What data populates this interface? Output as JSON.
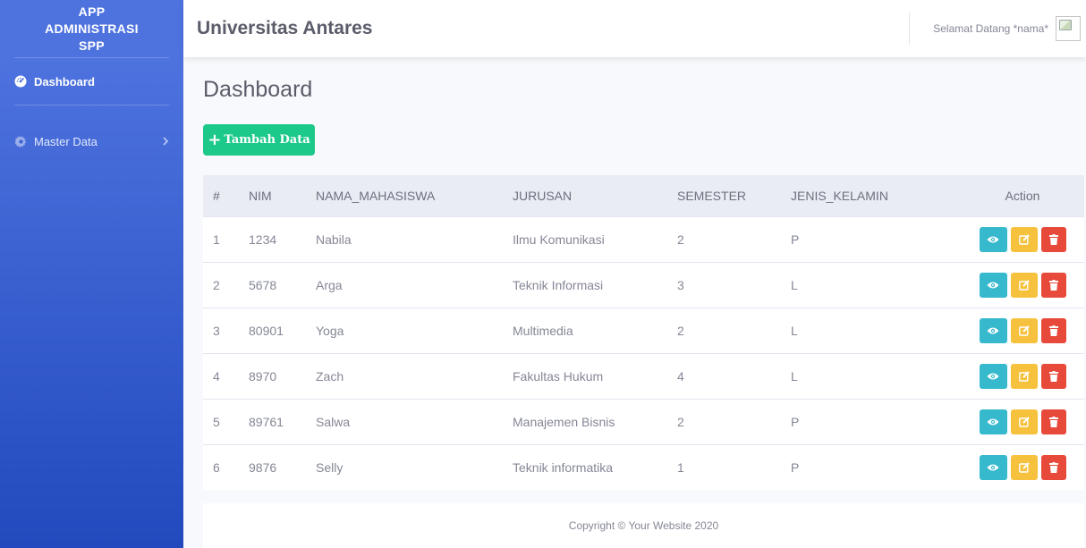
{
  "sidebar": {
    "brand_lines": [
      "APP",
      "ADMINISTRASI",
      "SPP"
    ],
    "items": [
      {
        "label": "Dashboard",
        "icon": "tachometer-icon",
        "active": true
      },
      {
        "label": "Master Data",
        "icon": "gear-icon",
        "active": false,
        "chevron": "chevron-right-icon"
      }
    ]
  },
  "topbar": {
    "title": "Universitas Antares",
    "greeting": "Selamat Datang *nama*"
  },
  "page": {
    "title": "Dashboard",
    "add_button": "Tambah Data"
  },
  "table": {
    "headers": [
      "#",
      "NIM",
      "NAMA_MAHASISWA",
      "JURUSAN",
      "SEMESTER",
      "JENIS_KELAMIN",
      "Action"
    ],
    "rows": [
      {
        "no": "1",
        "nim": "1234",
        "nama": "Nabila",
        "jurusan": "Ilmu Komunikasi",
        "semester": "2",
        "jk": "P"
      },
      {
        "no": "2",
        "nim": "5678",
        "nama": "Arga",
        "jurusan": "Teknik Informasi",
        "semester": "3",
        "jk": "L"
      },
      {
        "no": "3",
        "nim": "80901",
        "nama": "Yoga",
        "jurusan": "Multimedia",
        "semester": "2",
        "jk": "L"
      },
      {
        "no": "4",
        "nim": "8970",
        "nama": "Zach",
        "jurusan": "Fakultas Hukum",
        "semester": "4",
        "jk": "L"
      },
      {
        "no": "5",
        "nim": "89761",
        "nama": "Salwa",
        "jurusan": "Manajemen Bisnis",
        "semester": "2",
        "jk": "P"
      },
      {
        "no": "6",
        "nim": "9876",
        "nama": "Selly",
        "jurusan": "Teknik informatika",
        "semester": "1",
        "jk": "P"
      }
    ]
  },
  "footer": {
    "text": "Copyright © Your Website 2020"
  },
  "colors": {
    "sidebar_top": "#4e73df",
    "sidebar_bottom": "#224abe",
    "success": "#1cc88a",
    "info": "#36b9cc",
    "warning": "#f6c23e",
    "danger": "#e74a3b"
  }
}
